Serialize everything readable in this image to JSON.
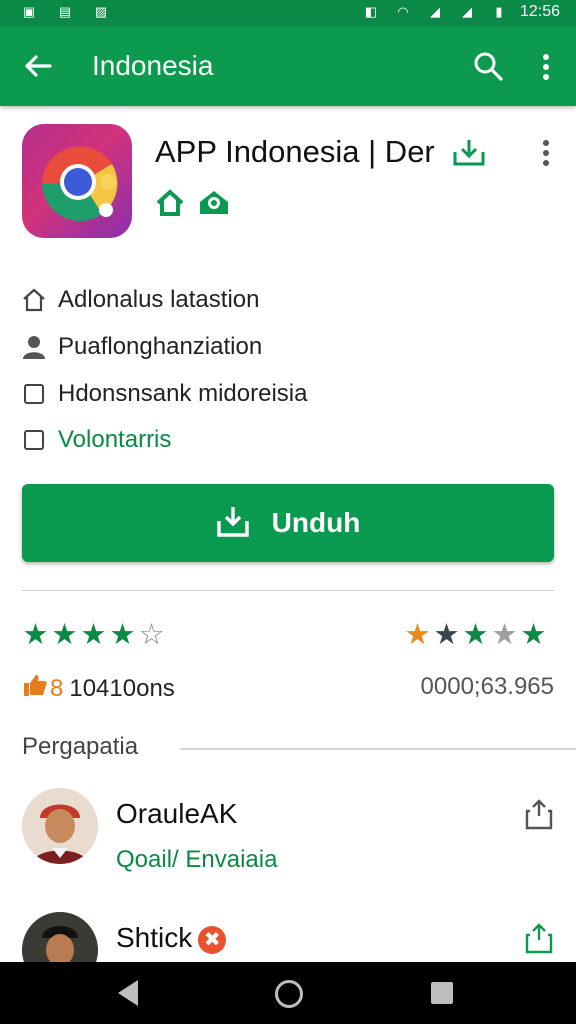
{
  "status_bar": {
    "time": "12:56",
    "icons": [
      "app-notification-icon",
      "chart-icon",
      "image-icon",
      "vibrate-icon",
      "wifi-icon",
      "signal-icon",
      "battery-icon"
    ]
  },
  "app_bar": {
    "title": "Indonesia",
    "back_icon": "arrow-left-icon",
    "search_icon": "search-icon",
    "more_icon": "more-vert-icon"
  },
  "app": {
    "title": "APP Indonesia | Der",
    "badges": [
      "home-badge-icon",
      "eye-badge-icon"
    ]
  },
  "info_rows": [
    {
      "icon": "home-outline-icon",
      "text": "Adlonalus  latastion"
    },
    {
      "icon": "person-icon",
      "text": "Puaflonghanziation"
    },
    {
      "icon": "checkbox-icon",
      "text": "Hdonsnsank midoreisia"
    },
    {
      "icon": "checkbox-icon",
      "text": "Volontarris"
    }
  ],
  "install_button": {
    "label": "Unduh",
    "icon": "download-icon"
  },
  "ratings": {
    "left_stars": 3.5,
    "right_stars": [
      "orange",
      "dark",
      "green",
      "gray",
      "green"
    ],
    "left_count_prefix": "8",
    "left_count_text": "10410ons",
    "right_count": "0000;63.965"
  },
  "section": {
    "label": "Pergapatia"
  },
  "reviews": [
    {
      "name": "OrauleAK",
      "subtitle": "Qoail/ Envaiaia",
      "share_icon": "share-icon"
    },
    {
      "name": "Shtick",
      "badge": "✖",
      "share_icon": "share-icon"
    }
  ],
  "colors": {
    "primary": "#0b9a4e",
    "status": "#0b8a47",
    "accent_orange": "#e87b1c",
    "star_green": "#0a8a45"
  }
}
